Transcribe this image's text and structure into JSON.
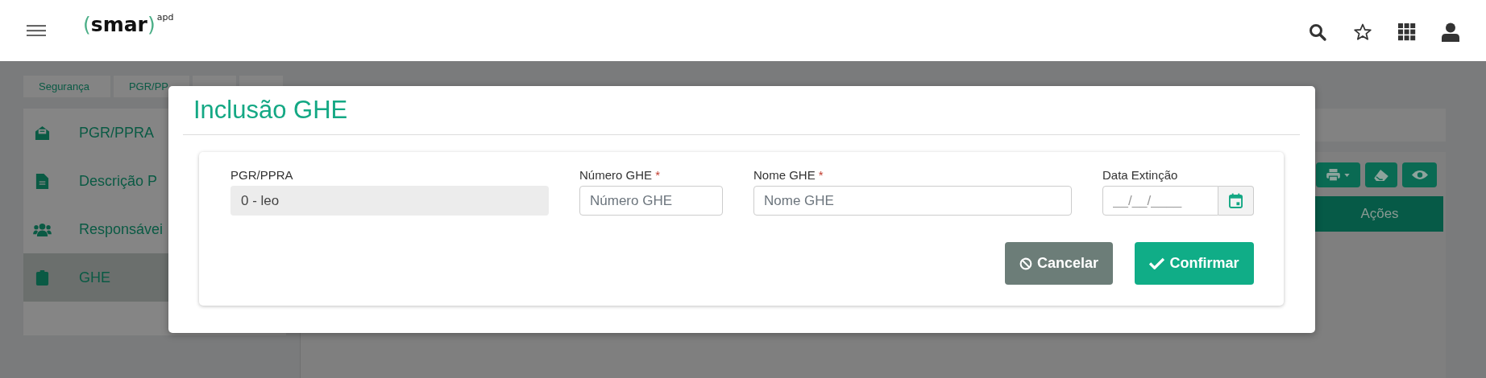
{
  "header": {
    "logo": {
      "open": "(",
      "name": "smar",
      "close": ")",
      "sup": "apd"
    },
    "actions": [
      {
        "kind": "search"
      },
      {
        "kind": "star"
      },
      {
        "kind": "apps"
      },
      {
        "kind": "user"
      }
    ]
  },
  "breadcrumbs": [
    {
      "label": "Segurança"
    },
    {
      "label": "PGR/PP"
    }
  ],
  "sidebar": {
    "items": [
      {
        "label": "PGR/PPRA",
        "selected": false
      },
      {
        "label": "Descrição P",
        "selected": false
      },
      {
        "label": "Responsávei",
        "selected": false
      },
      {
        "label": "GHE",
        "selected": true
      }
    ]
  },
  "toolbar": [
    {
      "kind": "print"
    },
    {
      "kind": "eraser"
    },
    {
      "kind": "eye"
    }
  ],
  "table": {
    "columns": [
      "Ações"
    ]
  },
  "modal": {
    "title": "Inclusão GHE",
    "fields": [
      {
        "label": "PGR/PPRA",
        "kind": "readonly",
        "value": "0 - leo"
      },
      {
        "label": "Número GHE",
        "required_mark": "*",
        "kind": "text",
        "placeholder": "Número GHE"
      },
      {
        "label": "Nome GHE",
        "required_mark": "*",
        "kind": "text",
        "placeholder": "Nome GHE"
      },
      {
        "label": "Data Extinção",
        "kind": "date",
        "placeholder": "__/__/____"
      }
    ],
    "buttons": [
      {
        "label": "Cancelar",
        "kind": "cancel"
      },
      {
        "label": "Confirmar",
        "kind": "confirm"
      }
    ]
  }
}
